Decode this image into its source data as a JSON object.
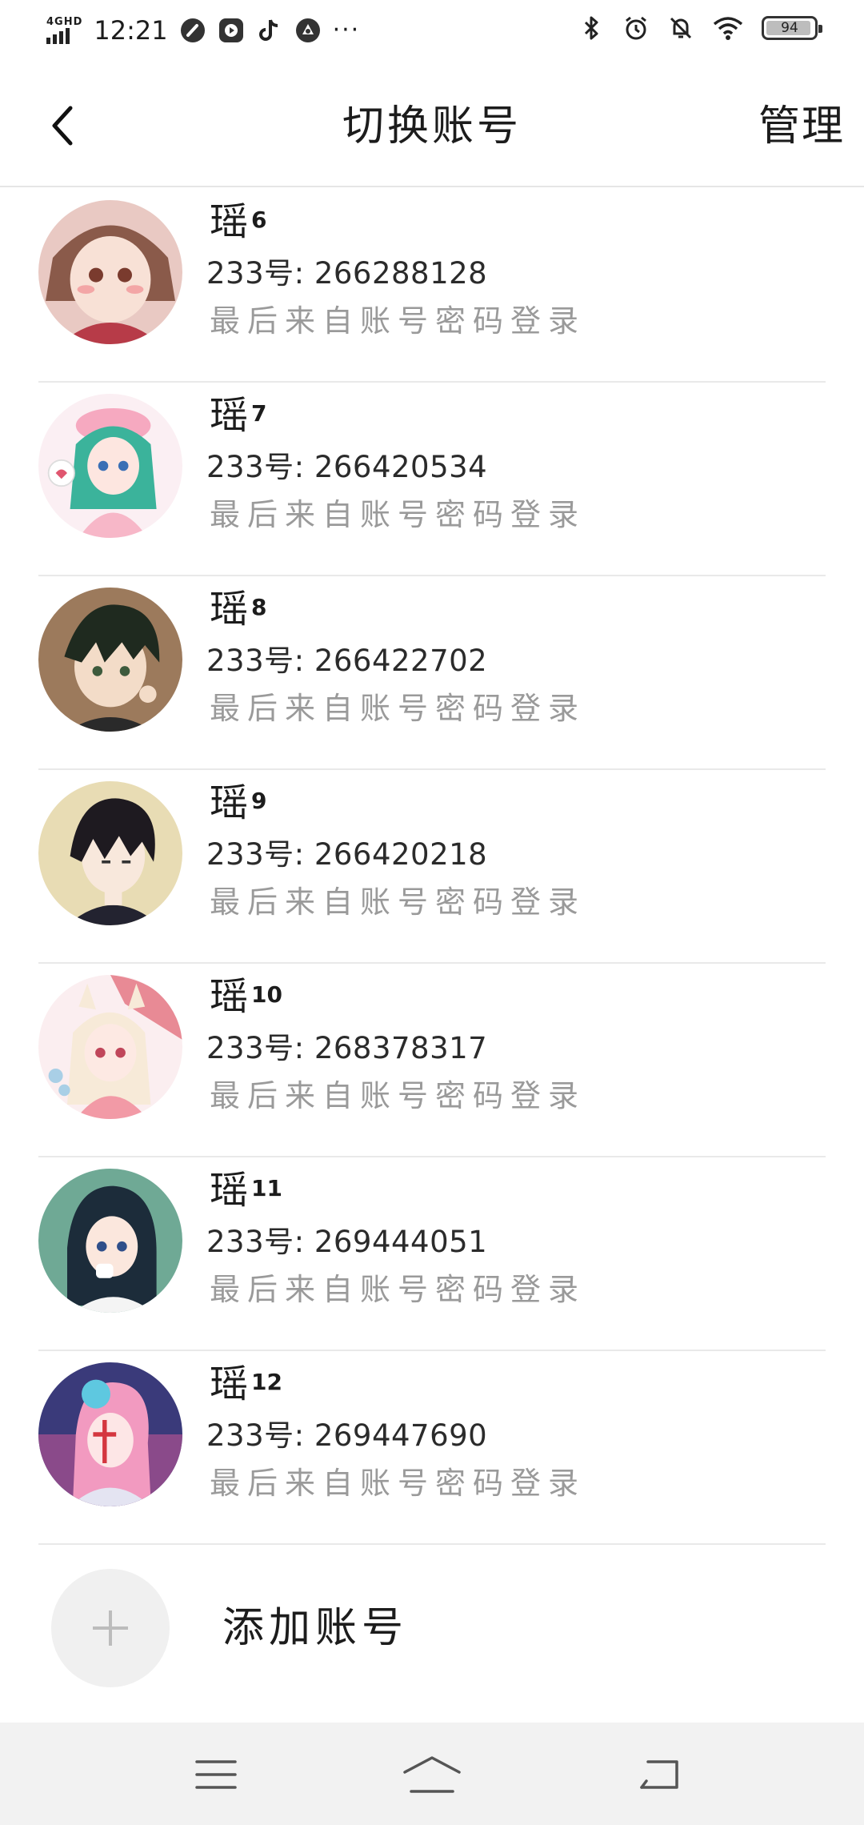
{
  "status_bar": {
    "network_label": "4GHD",
    "time": "12:21",
    "battery": "94",
    "battery_level": 0.94,
    "overflow": "···"
  },
  "header": {
    "title": "切换账号",
    "manage_label": "管理"
  },
  "accounts": [
    {
      "name": "瑶",
      "suffix": "6",
      "id_text": "233号: 266288128",
      "source": "最后来自账号密码登录"
    },
    {
      "name": "瑶",
      "suffix": "7",
      "id_text": "233号: 266420534",
      "source": "最后来自账号密码登录"
    },
    {
      "name": "瑶",
      "suffix": "8",
      "id_text": "233号: 266422702",
      "source": "最后来自账号密码登录"
    },
    {
      "name": "瑶",
      "suffix": "9",
      "id_text": "233号: 266420218",
      "source": "最后来自账号密码登录"
    },
    {
      "name": "瑶",
      "suffix": "10",
      "id_text": "233号: 268378317",
      "source": "最后来自账号密码登录"
    },
    {
      "name": "瑶",
      "suffix": "11",
      "id_text": "233号: 269444051",
      "source": "最后来自账号密码登录"
    },
    {
      "name": "瑶",
      "suffix": "12",
      "id_text": "233号: 269447690",
      "source": "最后来自账号密码登录"
    }
  ],
  "add_account": {
    "label": "添加账号"
  },
  "icons": {
    "back": "chevron-left-icon",
    "add": "plus-icon",
    "nav_menu": "menu-icon",
    "nav_home": "home-icon",
    "nav_back": "back-arrow-icon"
  },
  "colors": {
    "text_primary": "#1c1c1c",
    "text_secondary": "#9a9a9a",
    "divider": "#e9e9e9",
    "nav_bg": "#f2f2f2"
  }
}
